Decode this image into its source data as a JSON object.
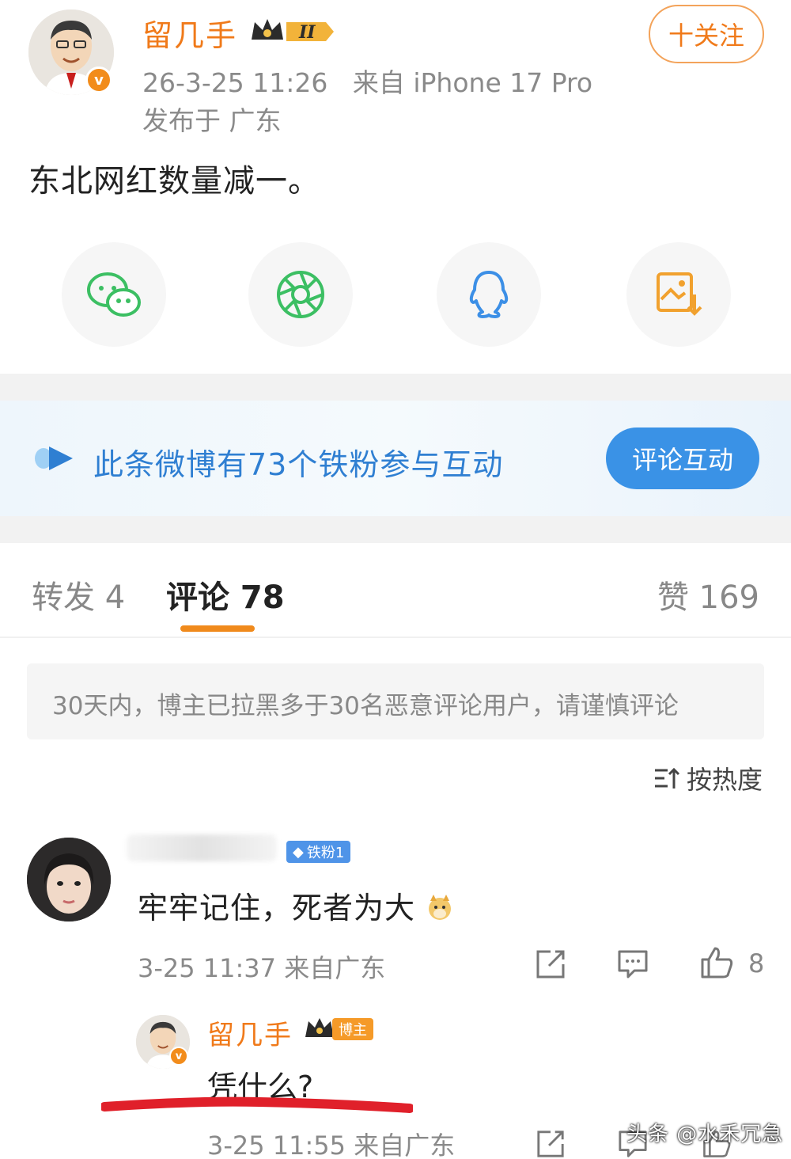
{
  "post": {
    "author_name": "留几手",
    "crown_label": "II",
    "timestamp": "26-3-25 11:26",
    "source": "来自 iPhone 17 Pro",
    "location": "发布于 广东",
    "follow_label": "十关注",
    "text": "东北网红数量减一。"
  },
  "share": {
    "items": [
      {
        "icon": "wechat-icon",
        "color": "#3cbf63"
      },
      {
        "icon": "moments-icon",
        "color": "#3cbf63"
      },
      {
        "icon": "qq-icon",
        "color": "#3c8fe6"
      },
      {
        "icon": "save-image-icon",
        "color": "#f1a12e"
      }
    ]
  },
  "fans_bar": {
    "text": "此条微博有73个铁粉参与互动",
    "button_label": "评论互动"
  },
  "tabs": {
    "repost": "转发 4",
    "comment": "评论 78",
    "likes": "赞 169"
  },
  "notice": "30天内，博主已拉黑多于30名恶意评论用户，请谨慎评论",
  "sort_label": "按热度",
  "comment": {
    "fan_badge": "铁粉1",
    "text": "牢牢记住，死者为大",
    "time": "3-25 11:37 来自广东",
    "likes": "8"
  },
  "reply": {
    "author_name": "留几手",
    "badge_label": "博主",
    "text": "凭什么?",
    "time": "3-25 11:55 来自广东"
  },
  "watermark": "头条 @水禾冗急",
  "colors": {
    "accent_orange": "#f07a1a",
    "link_blue": "#2f7fd2",
    "underline_red": "#e0202a"
  }
}
